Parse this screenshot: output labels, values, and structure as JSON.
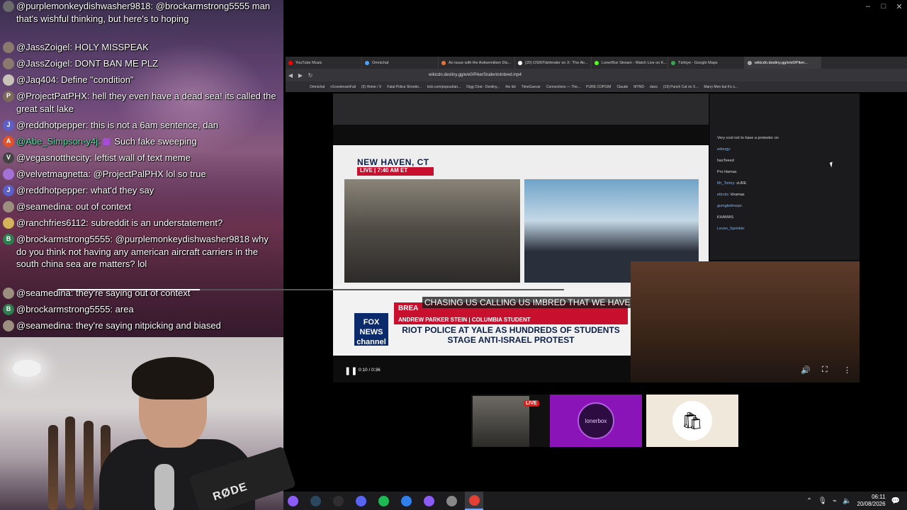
{
  "chat": {
    "messages": [
      {
        "user": "@purplemonkeydishwasher9818:",
        "text": " @brockarmstrong5555 man that's wishful thinking, but here's to hoping",
        "avatar": "",
        "avatar_color": "#6b6b6b",
        "user_color": "#ffffff"
      },
      {
        "user": "@JassZoigel:",
        "text": " HOLY MISSPEAK",
        "avatar": "",
        "avatar_color": "#8a7a6e",
        "user_color": "#ffffff"
      },
      {
        "user": "@JassZoigel:",
        "text": " DONT BAN ME PLZ",
        "avatar": "",
        "avatar_color": "#8a7a6e",
        "user_color": "#ffffff"
      },
      {
        "user": "@Jaq404:",
        "text": " Define \"condition\"",
        "avatar": "",
        "avatar_color": "#c9c2b8",
        "user_color": "#ffffff"
      },
      {
        "user": "@ProjectPatPHX:",
        "text": " hell they even have a dead sea! its called the great salt lake",
        "avatar": "P",
        "avatar_color": "#7b6a5a",
        "user_color": "#ffffff"
      },
      {
        "user": "@reddhotpepper:",
        "text": " this is not a 6am sentence, dan",
        "avatar": "J",
        "avatar_color": "#5b5fc7",
        "user_color": "#ffffff"
      },
      {
        "user": "@Abe_Simpson-y4j:",
        "text": " Such fake sweeping",
        "avatar": "A",
        "avatar_color": "#e0522b",
        "user_color": "#4ee6a0",
        "badge": true
      },
      {
        "user": "@vegasnotthecity:",
        "text": " leftist wall of text meme",
        "avatar": "V",
        "avatar_color": "#444444",
        "user_color": "#ffffff"
      },
      {
        "user": "@velvetmagnetta:",
        "text": " @ProjectPalPHX lol so true",
        "avatar": "",
        "avatar_color": "#a471d6",
        "user_color": "#ffffff"
      },
      {
        "user": "@reddhotpepper:",
        "text": " what'd they say",
        "avatar": "J",
        "avatar_color": "#5b5fc7",
        "user_color": "#ffffff"
      },
      {
        "user": "@seamedina:",
        "text": " out of context",
        "avatar": "",
        "avatar_color": "#9c8f80",
        "user_color": "#ffffff"
      },
      {
        "user": "@ranchfries6112:",
        "text": " subreddit is an understatement?",
        "avatar": "",
        "avatar_color": "#d4b45a",
        "user_color": "#ffffff"
      },
      {
        "user": "@brockarmstrong5555:",
        "text": " @purplemonkeydishwasher9818 why do you think not having any american aircraft carriers in the south china sea are matters? lol",
        "avatar": "B",
        "avatar_color": "#2e7d4f",
        "user_color": "#ffffff"
      },
      {
        "user": "@seamedina:",
        "text": " they're saying out of context",
        "avatar": "",
        "avatar_color": "#9c8f80",
        "user_color": "#ffffff"
      },
      {
        "user": "@brockarmstrong5555:",
        "text": " area",
        "avatar": "B",
        "avatar_color": "#2e7d4f",
        "user_color": "#ffffff"
      },
      {
        "user": "@seamedina:",
        "text": " they're saying nitpicking and biased",
        "avatar": "",
        "avatar_color": "#9c8f80",
        "user_color": "#ffffff"
      }
    ]
  },
  "webcam": {
    "mic_brand": "RØDE"
  },
  "browser": {
    "tabs": [
      {
        "label": "YouTube Music",
        "color": "#ff0000"
      },
      {
        "label": "Omnichat",
        "color": "#4aa3ff"
      },
      {
        "label": "An issue with the Antisemitism Dis...",
        "color": "#e8743b"
      },
      {
        "label": "(20) OSINTdefender on X: 'The Air...",
        "color": "#ffffff"
      },
      {
        "label": "LonerBox Stream - Watch Live on K...",
        "color": "#53fc18"
      },
      {
        "label": "Türkiye - Google Maps",
        "color": "#34a853"
      },
      {
        "label": "wikicdn.destiny.gg/e/e0/Piker...",
        "color": "#aaaaaa"
      }
    ],
    "url": "wikicdn.destiny.gg/e/e0/PikerStudentsInbred.mp4",
    "bookmarks": [
      "Omnichat",
      "r/LivestreamFail",
      "(5) Home / X",
      "Fatal Police Shootin...",
      "kick.com/popout/an...",
      "Digg Chat - Destiny...",
      "the list",
      "TimeGuessr",
      "Connections — The...",
      "PURE COPIUM",
      "Claude",
      "MYND",
      "dans",
      "(19) Punch Cat on X...",
      "Marry Men but it's s..."
    ]
  },
  "news": {
    "location": "NEW HAVEN, CT",
    "live_label": "LIVE | 7:40 AM ET",
    "caption": "CHASING US CALLING US IMBRED THAT WE HAVE N",
    "breaking": "BREA",
    "name_strip": "ANDREW PARKER STEIN | COLUMBIA STUDENT",
    "headline": "RIOT POLICE AT YALE AS HUNDREDS OF STUDENTS STAGE ANTI-ISRAEL PROTEST",
    "network": "FOX NEWS channel"
  },
  "inner_chat": {
    "lines": [
      {
        "n": "",
        "t": "Very cool not to have a protestor on"
      },
      {
        "n": "edoogy:",
        "t": ""
      },
      {
        "n": "",
        "t": "hasTeeed"
      },
      {
        "n": "",
        "t": "Pro Hamas"
      },
      {
        "n": "Mr_Torley:",
        "t": "sURE"
      },
      {
        "n": "ettcotc:",
        "t": "khamas"
      },
      {
        "n": "gumgledmops:",
        "t": ""
      },
      {
        "n": "",
        "t": "KHAMAS"
      },
      {
        "n": "Leven_Sprinkle:",
        "t": ""
      }
    ]
  },
  "video": {
    "time": "0:10 / 0:36",
    "progress": 0.28
  },
  "thumbs": {
    "live_label": "LIVE",
    "lonerbox_label": "lonerbox"
  },
  "taskbar": {
    "time": "06:11",
    "date": "20/08/2026",
    "icons": [
      {
        "name": "app-icon-1",
        "color": "#8b5cf6"
      },
      {
        "name": "steam-icon",
        "color": "#2a475e"
      },
      {
        "name": "obs-icon",
        "color": "#302e31"
      },
      {
        "name": "discord-icon",
        "color": "#5865f2"
      },
      {
        "name": "spotify-icon",
        "color": "#1db954"
      },
      {
        "name": "app-icon-2",
        "color": "#2f80ed"
      },
      {
        "name": "app-icon-3",
        "color": "#8b5cf6"
      },
      {
        "name": "app-icon-4",
        "color": "#888888"
      },
      {
        "name": "chrome-icon",
        "color": "#e34133"
      }
    ]
  }
}
